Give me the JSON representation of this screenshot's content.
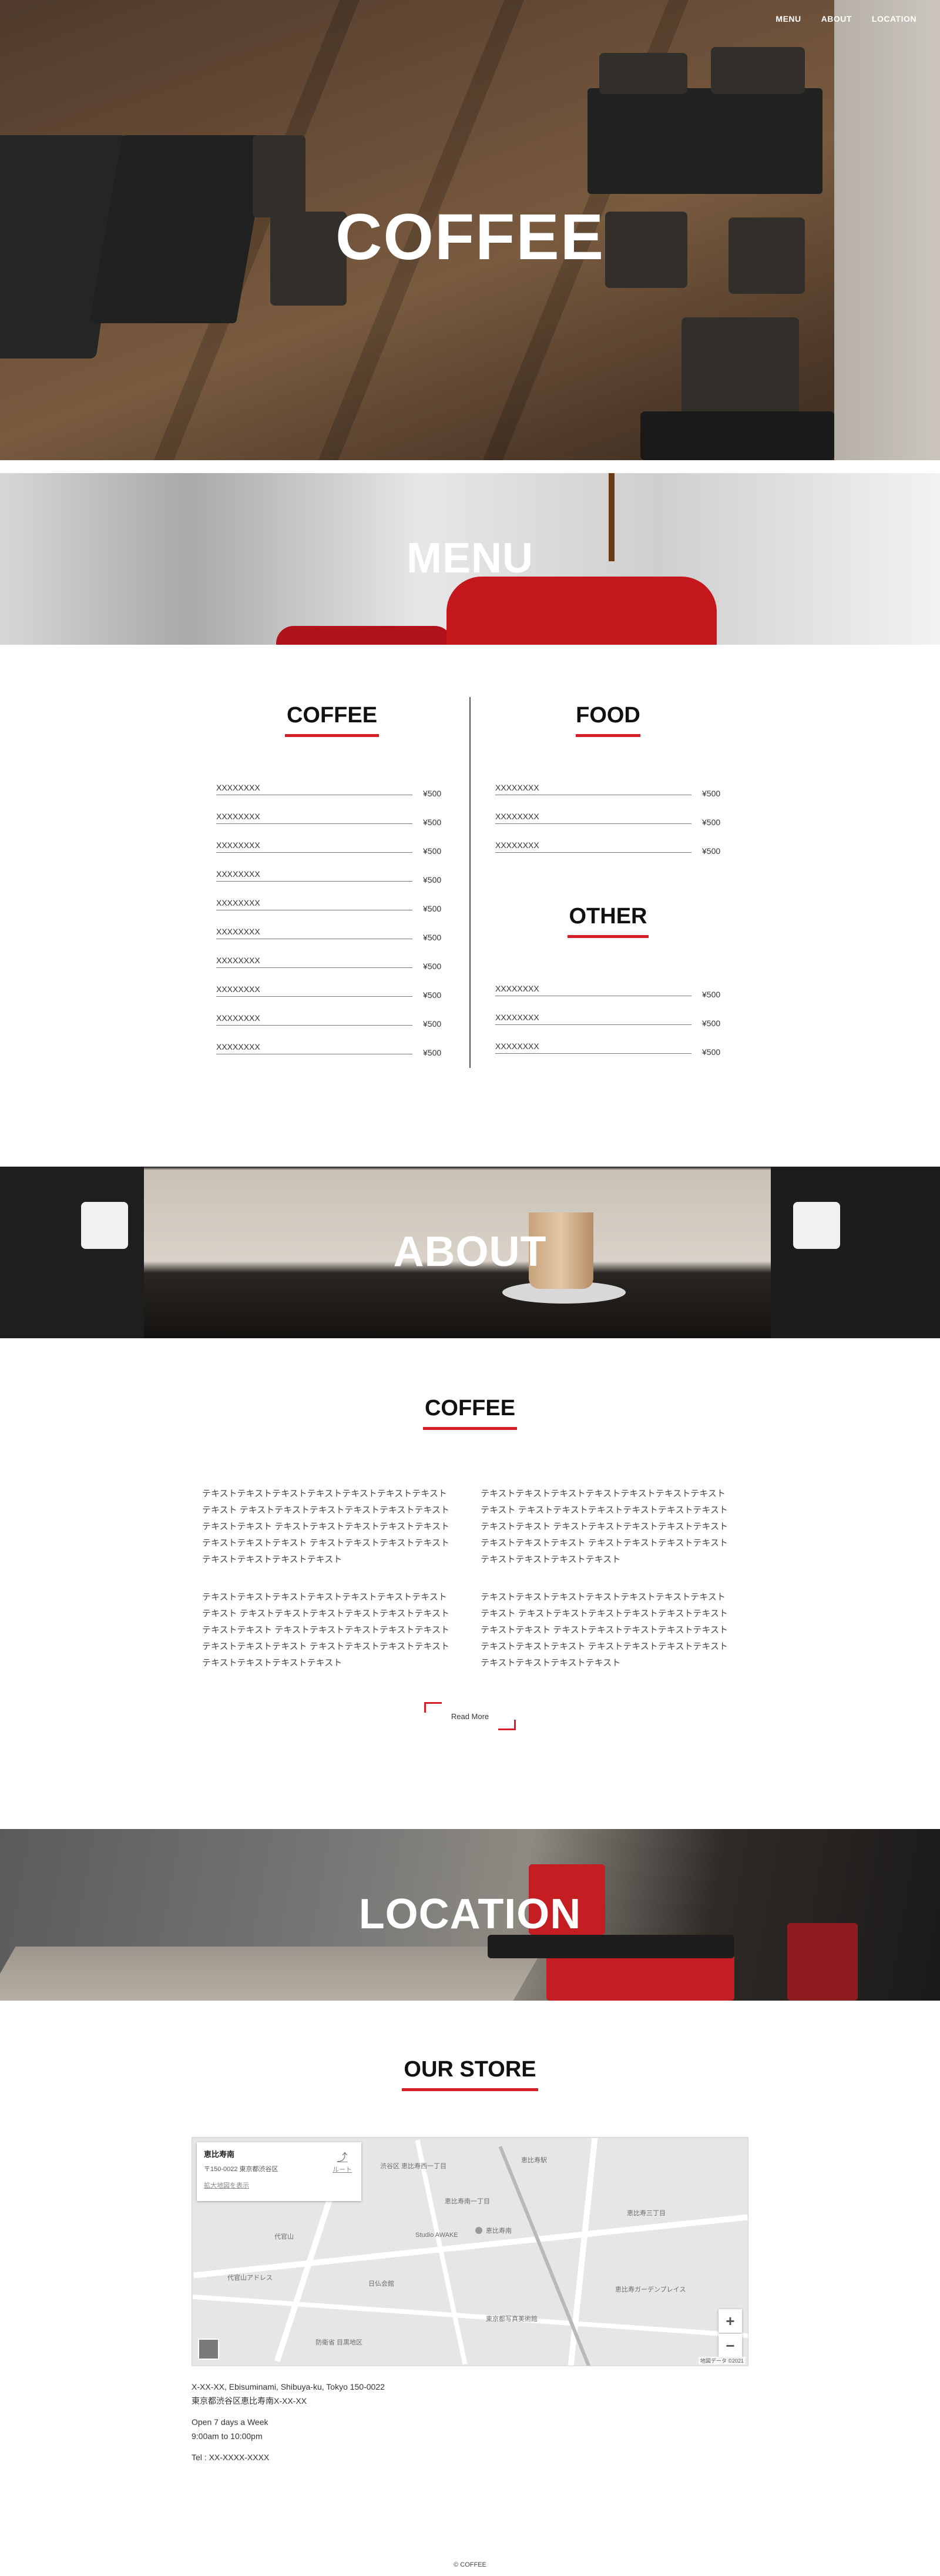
{
  "nav": {
    "items": [
      "MENU",
      "ABOUT",
      "LOCATION"
    ]
  },
  "hero": {
    "title": "COFFEE"
  },
  "banners": {
    "menu": "MENU",
    "about": "ABOUT",
    "location": "LOCATION"
  },
  "menu": {
    "coffee": {
      "title": "COFFEE",
      "items": [
        {
          "name": "XXXXXXXX",
          "price": "¥500"
        },
        {
          "name": "XXXXXXXX",
          "price": "¥500"
        },
        {
          "name": "XXXXXXXX",
          "price": "¥500"
        },
        {
          "name": "XXXXXXXX",
          "price": "¥500"
        },
        {
          "name": "XXXXXXXX",
          "price": "¥500"
        },
        {
          "name": "XXXXXXXX",
          "price": "¥500"
        },
        {
          "name": "XXXXXXXX",
          "price": "¥500"
        },
        {
          "name": "XXXXXXXX",
          "price": "¥500"
        },
        {
          "name": "XXXXXXXX",
          "price": "¥500"
        },
        {
          "name": "XXXXXXXX",
          "price": "¥500"
        }
      ]
    },
    "food": {
      "title": "FOOD",
      "items": [
        {
          "name": "XXXXXXXX",
          "price": "¥500"
        },
        {
          "name": "XXXXXXXX",
          "price": "¥500"
        },
        {
          "name": "XXXXXXXX",
          "price": "¥500"
        }
      ]
    },
    "other": {
      "title": "OTHER",
      "items": [
        {
          "name": "XXXXXXXX",
          "price": "¥500"
        },
        {
          "name": "XXXXXXXX",
          "price": "¥500"
        },
        {
          "name": "XXXXXXXX",
          "price": "¥500"
        }
      ]
    }
  },
  "about": {
    "title": "COFFEE",
    "paragraphs": [
      "テキストテキストテキストテキストテキストテキストテキストテキスト テキストテキストテキストテキストテキストテキストテキストテキスト テキストテキストテキストテキストテキストテキストテキストテキスト テキストテキストテキストテキストテキストテキストテキストテキスト",
      "テキストテキストテキストテキストテキストテキストテキストテキスト テキストテキストテキストテキストテキストテキストテキストテキスト テキストテキストテキストテキストテキストテキストテキストテキスト テキストテキストテキストテキストテキストテキストテキストテキスト",
      "テキストテキストテキストテキストテキストテキストテキストテキスト テキストテキストテキストテキストテキストテキストテキストテキスト テキストテキストテキストテキストテキストテキストテキストテキスト テキストテキストテキストテキストテキストテキストテキストテキスト",
      "テキストテキストテキストテキストテキストテキストテキストテキスト テキストテキストテキストテキストテキストテキストテキストテキスト テキストテキストテキストテキストテキストテキストテキストテキスト テキストテキストテキストテキストテキストテキストテキストテキスト"
    ],
    "read_more": "Read More"
  },
  "store": {
    "title": "OUR STORE",
    "map": {
      "place_name": "恵比寿南",
      "place_address": "〒150-0022 東京都渋谷区",
      "enlarge": "拡大地図を表示",
      "route": "ルート",
      "zoom_in": "+",
      "zoom_out": "−",
      "attribution": "地図データ ©2021",
      "labels": [
        "恵比寿南",
        "渋谷区 恵比寿西一丁目",
        "恵比寿駅",
        "恵比寿南一丁目",
        "Studio AWAKE",
        "代官山",
        "恵比寿三丁目",
        "恵比寿ガーデンプレイス",
        "東京都写真美術館",
        "日仏会館",
        "代官山アドレス",
        "防衛省 目黒地区"
      ]
    },
    "address_en": "X-XX-XX, Ebisuminami, Shibuya-ku, Tokyo 150-0022",
    "address_jp": "東京都渋谷区恵比寿南X-XX-XX",
    "hours_line1": "Open 7 days a Week",
    "hours_line2": "9:00am to 10:00pm",
    "tel": "Tel : XX-XXXX-XXXX"
  },
  "footer": {
    "copyright": "© COFFEE"
  },
  "colors": {
    "accent": "#d51f26",
    "text": "#222222",
    "divider": "#555555"
  }
}
